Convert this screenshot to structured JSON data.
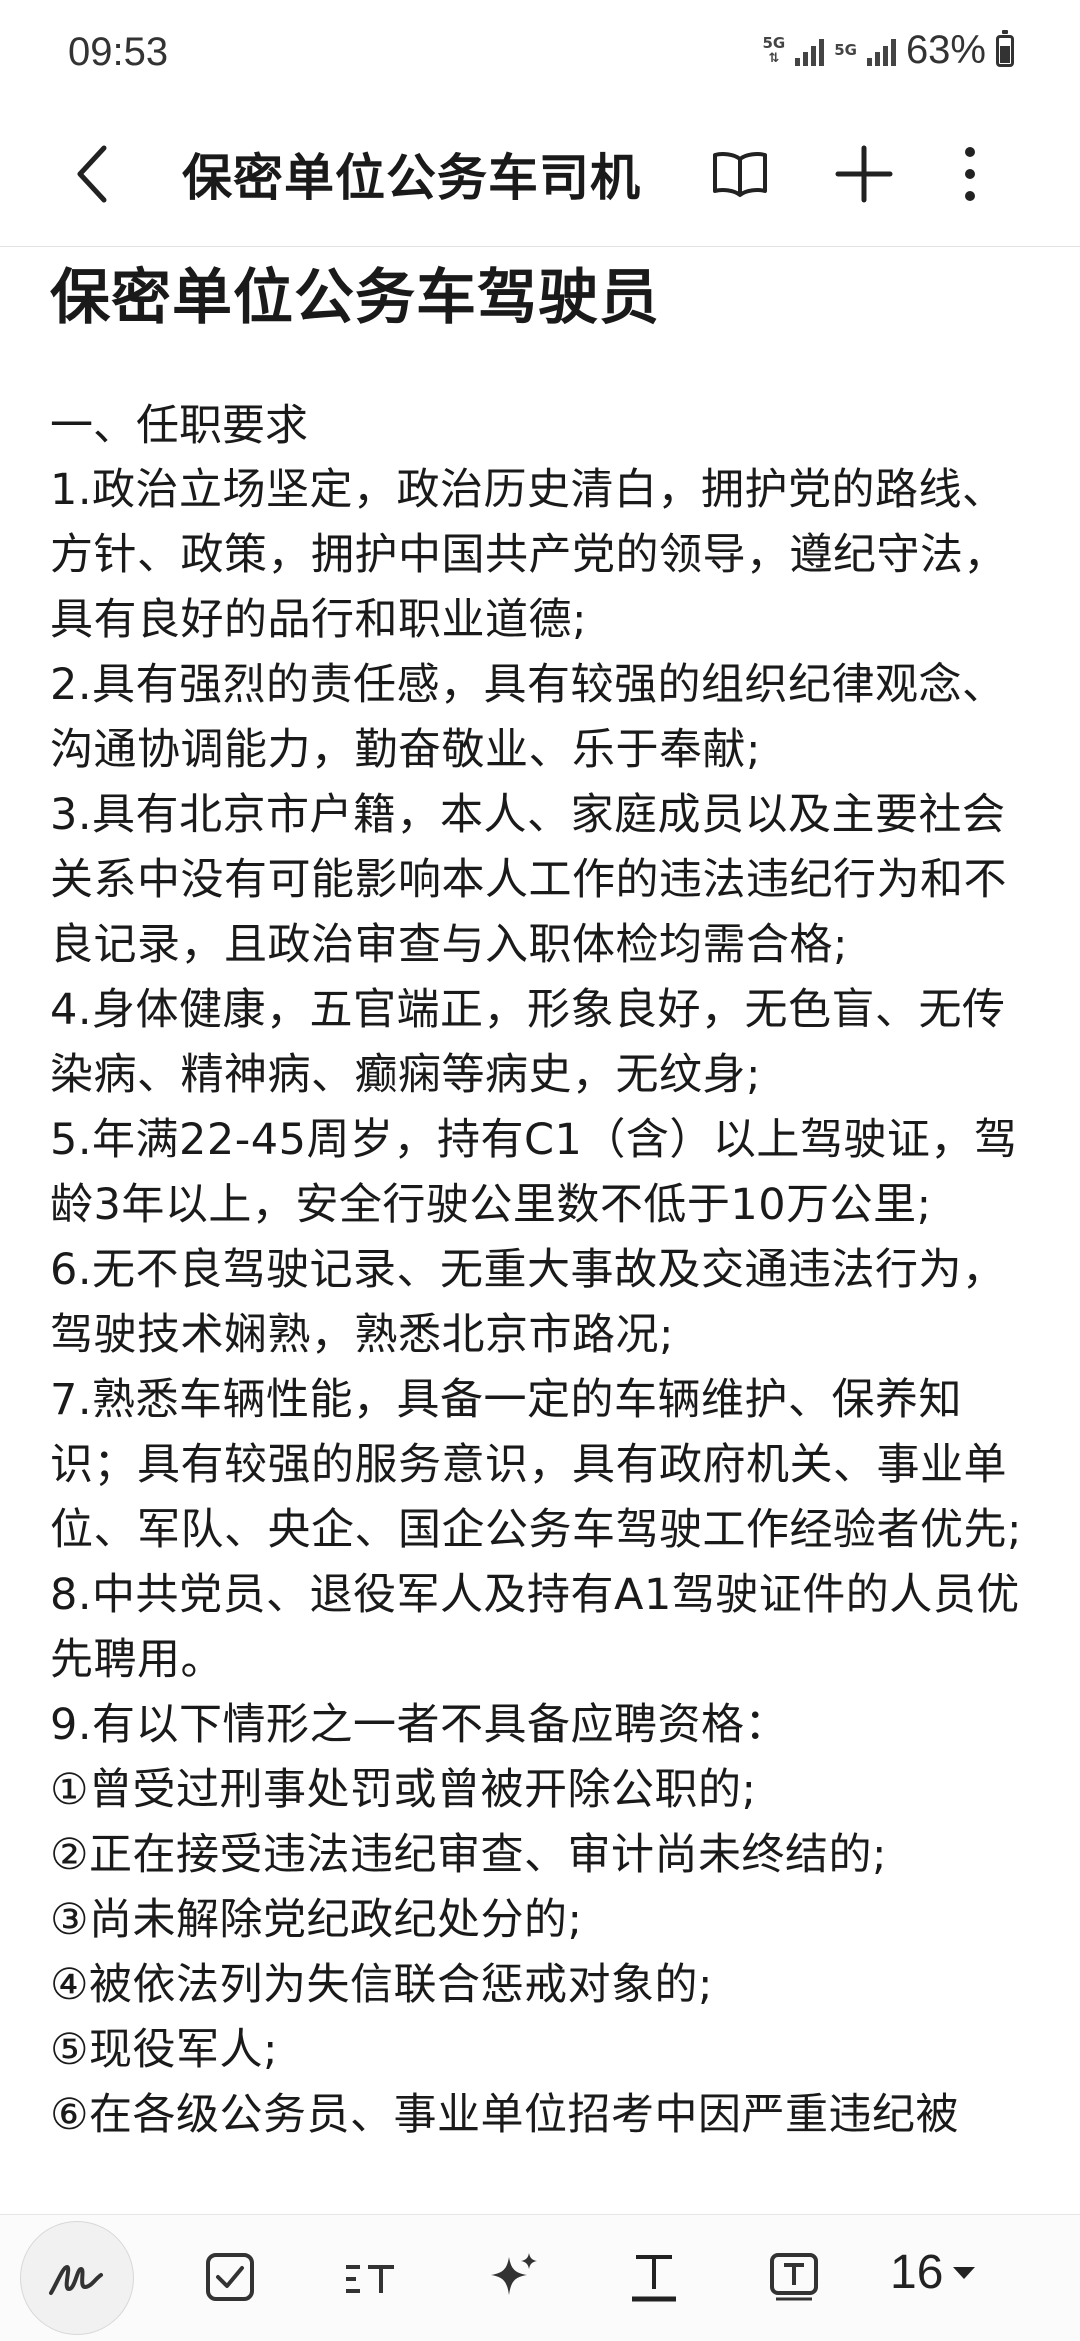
{
  "status_bar": {
    "time": "09:53",
    "network_1": "5G",
    "network_2": "5G",
    "battery_percent": "63%",
    "battery_level": 0.63
  },
  "toolbar": {
    "title": "保密单位公务车司机"
  },
  "document": {
    "heading": "保密单位公务车驾驶员",
    "section_title": "一、任职要求",
    "paragraphs": [
      "1.政治立场坚定，政治历史清白，拥护党的路线、方针、政策，拥护中国共产党的领导，遵纪守法，具有良好的品行和职业道德;",
      "2.具有强烈的责任感，具有较强的组织纪律观念、沟通协调能力，勤奋敬业、乐于奉献;",
      "3.具有北京市户籍，本人、家庭成员以及主要社会关系中没有可能影响本人工作的违法违纪行为和不良记录，且政治审查与入职体检均需合格;",
      "4.身体健康，五官端正，形象良好，无色盲、无传染病、精神病、癫痫等病史，无纹身;",
      "5.年满22-45周岁，持有C1（含）以上驾驶证，驾龄3年以上，安全行驶公里数不低于10万公里;",
      "6.无不良驾驶记录、无重大事故及交通违法行为，驾驶技术娴熟，熟悉北京市路况;",
      "7.熟悉车辆性能，具备一定的车辆维护、保养知识；具有较强的服务意识，具有政府机关、事业单位、军队、央企、国企公务车驾驶工作经验者优先;",
      "8.中共党员、退役军人及持有A1驾驶证件的人员优先聘用。",
      "9.有以下情形之一者不具备应聘资格：",
      "①曾受过刑事处罚或曾被开除公职的;",
      "②正在接受违法违纪审查、审计尚未终结的;",
      "③尚未解除党纪政纪处分的;",
      "④被依法列为失信联合惩戒对象的;",
      "⑤现役军人;",
      "⑥在各级公务员、事业单位招考中因严重违纪被"
    ]
  },
  "bottom_bar": {
    "font_size": "16",
    "icons": [
      "pen-icon",
      "checkbox-icon",
      "text-style-icon",
      "ai-sparkle-icon",
      "text-format-icon",
      "text-box-icon",
      "dropdown-arrow-icon"
    ]
  }
}
